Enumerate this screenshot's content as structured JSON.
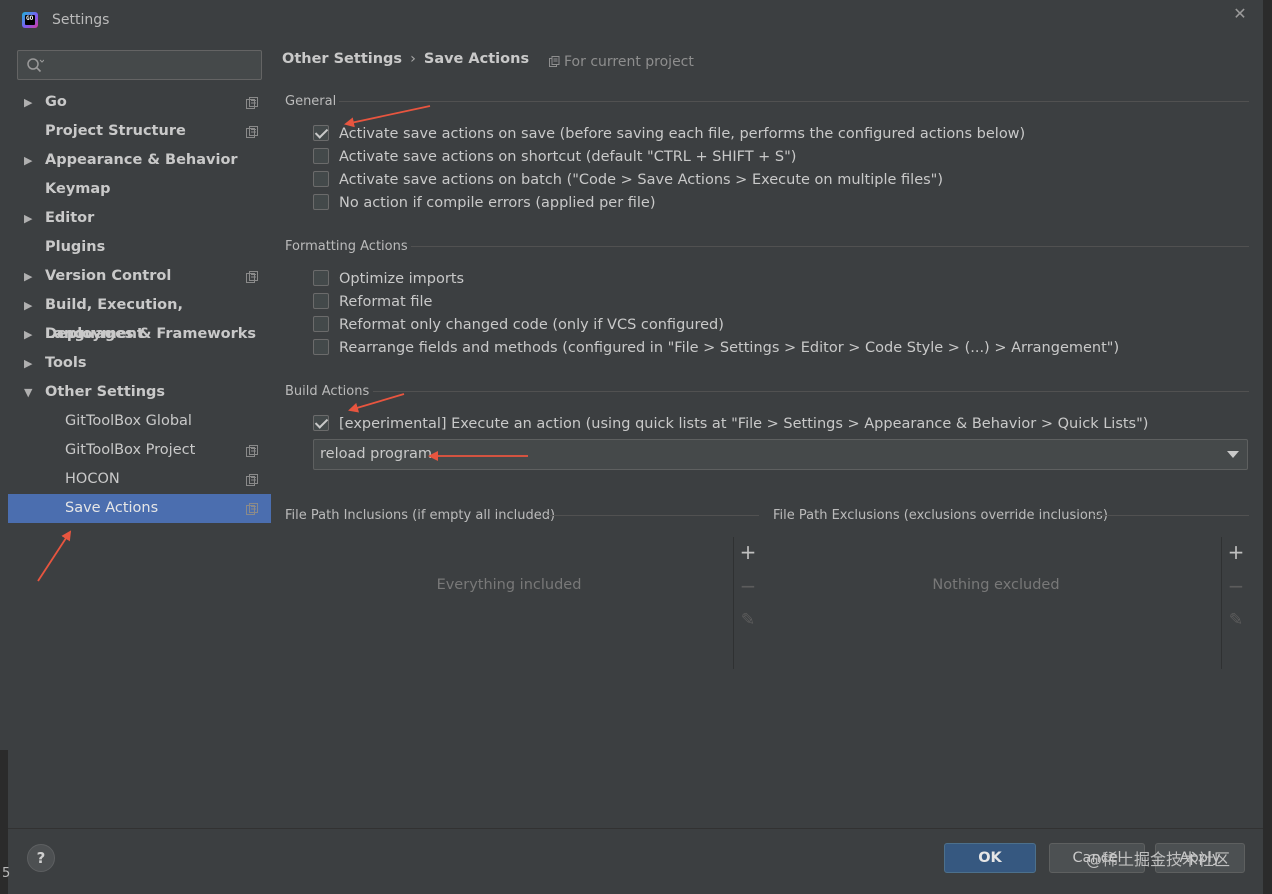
{
  "window": {
    "title": "Settings",
    "logo_text": "GO"
  },
  "search": {
    "placeholder": ""
  },
  "sidebar": {
    "items": [
      {
        "label": "Go",
        "arrow": "▶",
        "bold": true,
        "scope": true
      },
      {
        "label": "Project Structure",
        "arrow": "",
        "bold": true,
        "scope": true
      },
      {
        "label": "Appearance & Behavior",
        "arrow": "▶",
        "bold": true,
        "scope": false
      },
      {
        "label": "Keymap",
        "arrow": "",
        "bold": true,
        "scope": false
      },
      {
        "label": "Editor",
        "arrow": "▶",
        "bold": true,
        "scope": false
      },
      {
        "label": "Plugins",
        "arrow": "",
        "bold": true,
        "scope": false
      },
      {
        "label": "Version Control",
        "arrow": "▶",
        "bold": true,
        "scope": true
      },
      {
        "label": "Build, Execution, Deployment",
        "arrow": "▶",
        "bold": true,
        "scope": false
      },
      {
        "label": "Languages & Frameworks",
        "arrow": "▶",
        "bold": true,
        "scope": false
      },
      {
        "label": "Tools",
        "arrow": "▶",
        "bold": true,
        "scope": false
      },
      {
        "label": "Other Settings",
        "arrow": "▼",
        "bold": true,
        "scope": false
      },
      {
        "label": "GitToolBox Global",
        "arrow": "",
        "bold": false,
        "child": true,
        "scope": false
      },
      {
        "label": "GitToolBox Project",
        "arrow": "",
        "bold": false,
        "child": true,
        "scope": true
      },
      {
        "label": "HOCON",
        "arrow": "",
        "bold": false,
        "child": true,
        "scope": true
      },
      {
        "label": "Save Actions",
        "arrow": "",
        "bold": false,
        "child": true,
        "scope": true,
        "selected": true
      }
    ]
  },
  "breadcrumb": {
    "parent": "Other Settings",
    "separator": "›",
    "current": "Save Actions"
  },
  "scope_hint": "For current project",
  "sections": {
    "general": {
      "title": "General",
      "options": [
        {
          "label": "Activate save actions on save (before saving each file, performs the configured actions below)",
          "checked": true
        },
        {
          "label": "Activate save actions on shortcut (default \"CTRL + SHIFT + S\")",
          "checked": false
        },
        {
          "label": "Activate save actions on batch (\"Code > Save Actions > Execute on multiple files\")",
          "checked": false
        },
        {
          "label": "No action if compile errors (applied per file)",
          "checked": false
        }
      ]
    },
    "formatting": {
      "title": "Formatting Actions",
      "options": [
        {
          "label": "Optimize imports",
          "checked": false
        },
        {
          "label": "Reformat file",
          "checked": false
        },
        {
          "label": "Reformat only changed code (only if VCS configured)",
          "checked": false
        },
        {
          "label": "Rearrange fields and methods (configured in \"File > Settings > Editor > Code Style > (...) > Arrangement\")",
          "checked": false
        }
      ]
    },
    "build": {
      "title": "Build Actions",
      "options": [
        {
          "label": "[experimental] Execute an action (using quick lists at \"File > Settings > Appearance & Behavior > Quick Lists\")",
          "checked": true
        }
      ],
      "quick_list_value": "reload program"
    },
    "inclusions": {
      "title": "File Path Inclusions (if empty all included)",
      "empty_text": "Everything included"
    },
    "exclusions": {
      "title": "File Path Exclusions (exclusions override inclusions)",
      "empty_text": "Nothing excluded"
    }
  },
  "toolbar_icons": {
    "add": "+",
    "remove": "−",
    "edit": "✎"
  },
  "footer": {
    "help": "?",
    "ok": "OK",
    "cancel": "Cancel",
    "apply": "Apply"
  },
  "watermark": "@稀土掘金技术社区",
  "background_text": "5",
  "colors": {
    "selection": "#4b6eaf",
    "ok_button": "#365880",
    "annotation_arrow": "#e8553f"
  }
}
